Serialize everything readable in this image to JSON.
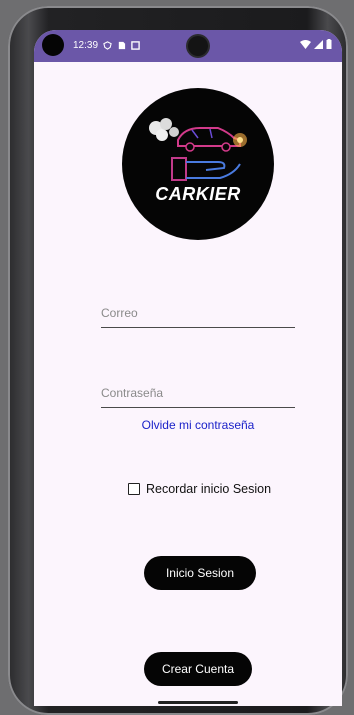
{
  "status_bar": {
    "time": "12:39",
    "left_icons": [
      "shield-icon",
      "sim-card-icon",
      "app-icon"
    ],
    "right_icons": [
      "wifi-icon",
      "signal-icon",
      "battery-icon"
    ],
    "color": "#6b57a8"
  },
  "logo": {
    "text": "CARKIER"
  },
  "login": {
    "email_placeholder": "Correo",
    "password_placeholder": "Contraseña",
    "forgot_link": "Olvide mi contraseña",
    "remember_label": "Recordar inicio Sesion",
    "remember_checked": false,
    "login_button": "Inicio Sesion",
    "create_account_button": "Crear Cuenta"
  },
  "colors": {
    "screen_background": "#fcf5fd",
    "link": "#1b22c9",
    "button": "#050505"
  }
}
